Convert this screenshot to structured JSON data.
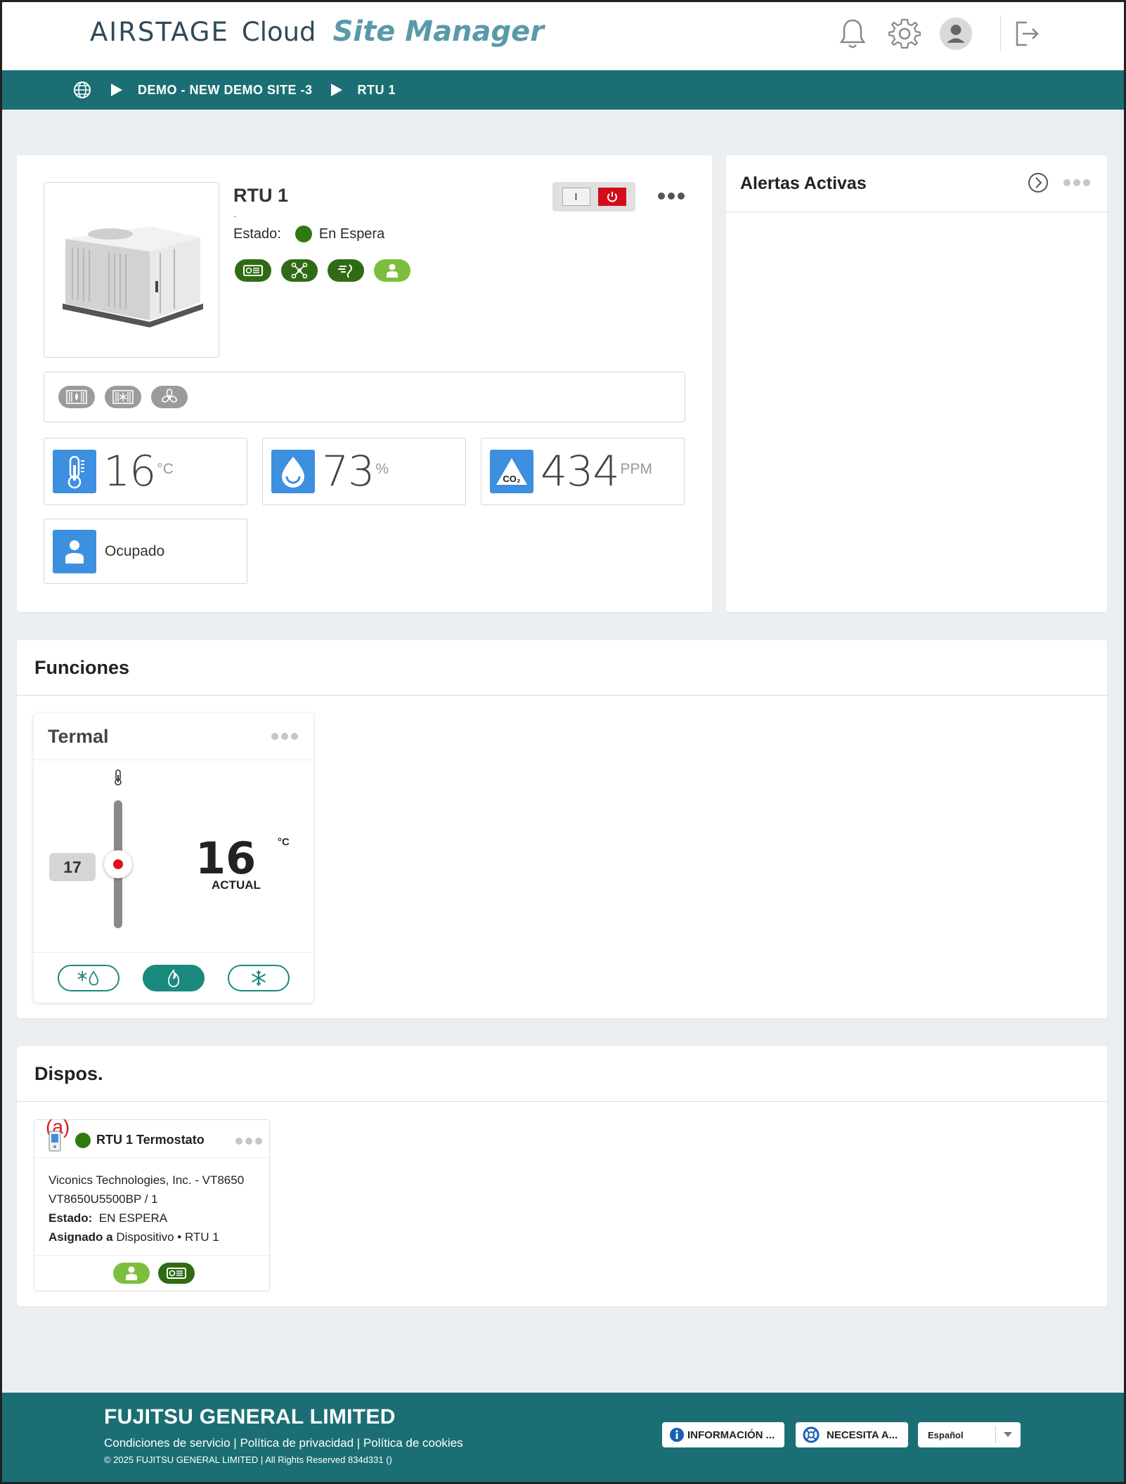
{
  "header": {
    "brand_main": "AIRSTAGE",
    "brand_cloud": "Cloud",
    "brand_product": "Site Manager"
  },
  "breadcrumb": {
    "site": "DEMO - NEW DEMO SITE -3",
    "device": "RTU 1"
  },
  "device": {
    "name": "RTU 1",
    "subtitle": "-",
    "state_label": "Estado:",
    "state_value": "En Espera",
    "power_on_label": "I",
    "temperature": "16",
    "temperature_unit": "°C",
    "humidity": "73",
    "humidity_unit": "%",
    "co2": "434",
    "co2_unit": "PPM",
    "co2_icon_label": "CO₂",
    "occupancy": "Ocupado"
  },
  "alerts": {
    "title": "Alertas Activas"
  },
  "functions": {
    "title": "Funciones",
    "thermal": {
      "title": "Termal",
      "setpoint": "17",
      "current": "16",
      "current_label": "ACTUAL",
      "unit": "°C",
      "active_mode": "heat"
    }
  },
  "devices": {
    "title": "Dispos.",
    "annotation": "(a)",
    "item": {
      "name": "RTU 1 Termostato",
      "manufacturer": "Viconics Technologies, Inc. - VT8650",
      "model": "VT8650U5500BP / 1",
      "state_label": "Estado:",
      "state_value": "EN ESPERA",
      "assigned_label": "Asignado a",
      "assigned_value": "Dispositivo • RTU 1"
    }
  },
  "footer": {
    "company": "FUJITSU GENERAL LIMITED",
    "link_terms": "Condiciones de servicio",
    "link_privacy": "Política de privacidad",
    "link_cookies": "Política de cookies",
    "separator": "|",
    "copyright": "© 2025 FUJITSU GENERAL LIMITED | All Rights Reserved 834d331 ()",
    "info_button": "INFORMACIÓN ...",
    "help_button": "NECESITA A...",
    "language": "Español"
  },
  "colors": {
    "teal": "#1b6f74",
    "status_green": "#2f7a10",
    "metric_blue": "#3d8fe0",
    "power_red": "#d40c1a",
    "mode_teal": "#1b8a7e"
  }
}
